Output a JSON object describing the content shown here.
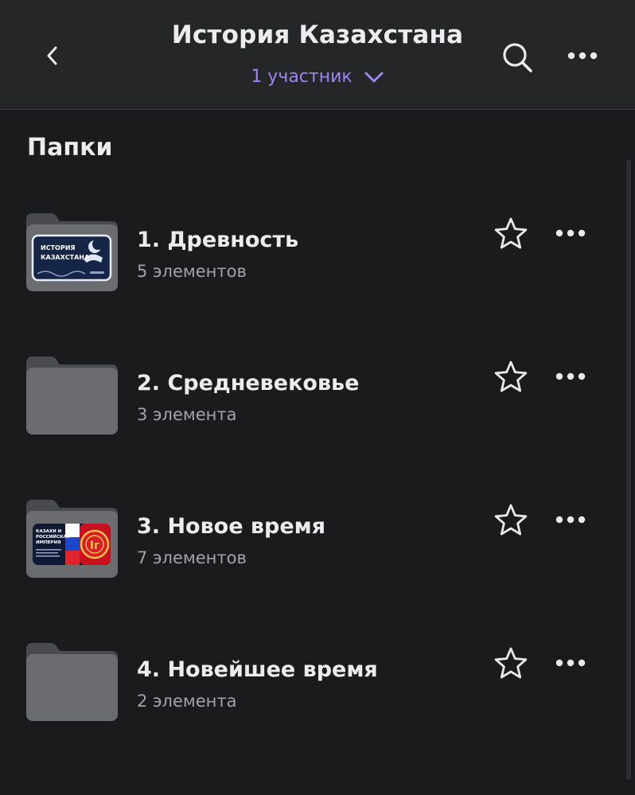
{
  "header": {
    "title": "История Казахстана",
    "members_label": "1 участник",
    "accent_color": "#a084f2"
  },
  "icons": {
    "back": "chevron-left-icon",
    "members_toggle": "chevron-down-icon",
    "search": "search-icon",
    "more": "more-horizontal-icon",
    "favorite": "star-outline-icon",
    "folder": "folder-icon"
  },
  "section_title": "Папки",
  "folders": [
    {
      "name": "1. Древность",
      "count": "5 элементов",
      "cover_title": [
        "ИСТОРИЯ",
        "КАЗАХСТАНА"
      ]
    },
    {
      "name": "2. Средневековье",
      "count": "3 элемента"
    },
    {
      "name": "3. Новое время",
      "count": "7 элементов",
      "cover_title": [
        "КАЗАХИ И",
        "РОССИЙСКАЯ",
        "ИМПЕРИЯ"
      ]
    },
    {
      "name": "4. Новейшее время",
      "count": "2 элемента"
    }
  ]
}
